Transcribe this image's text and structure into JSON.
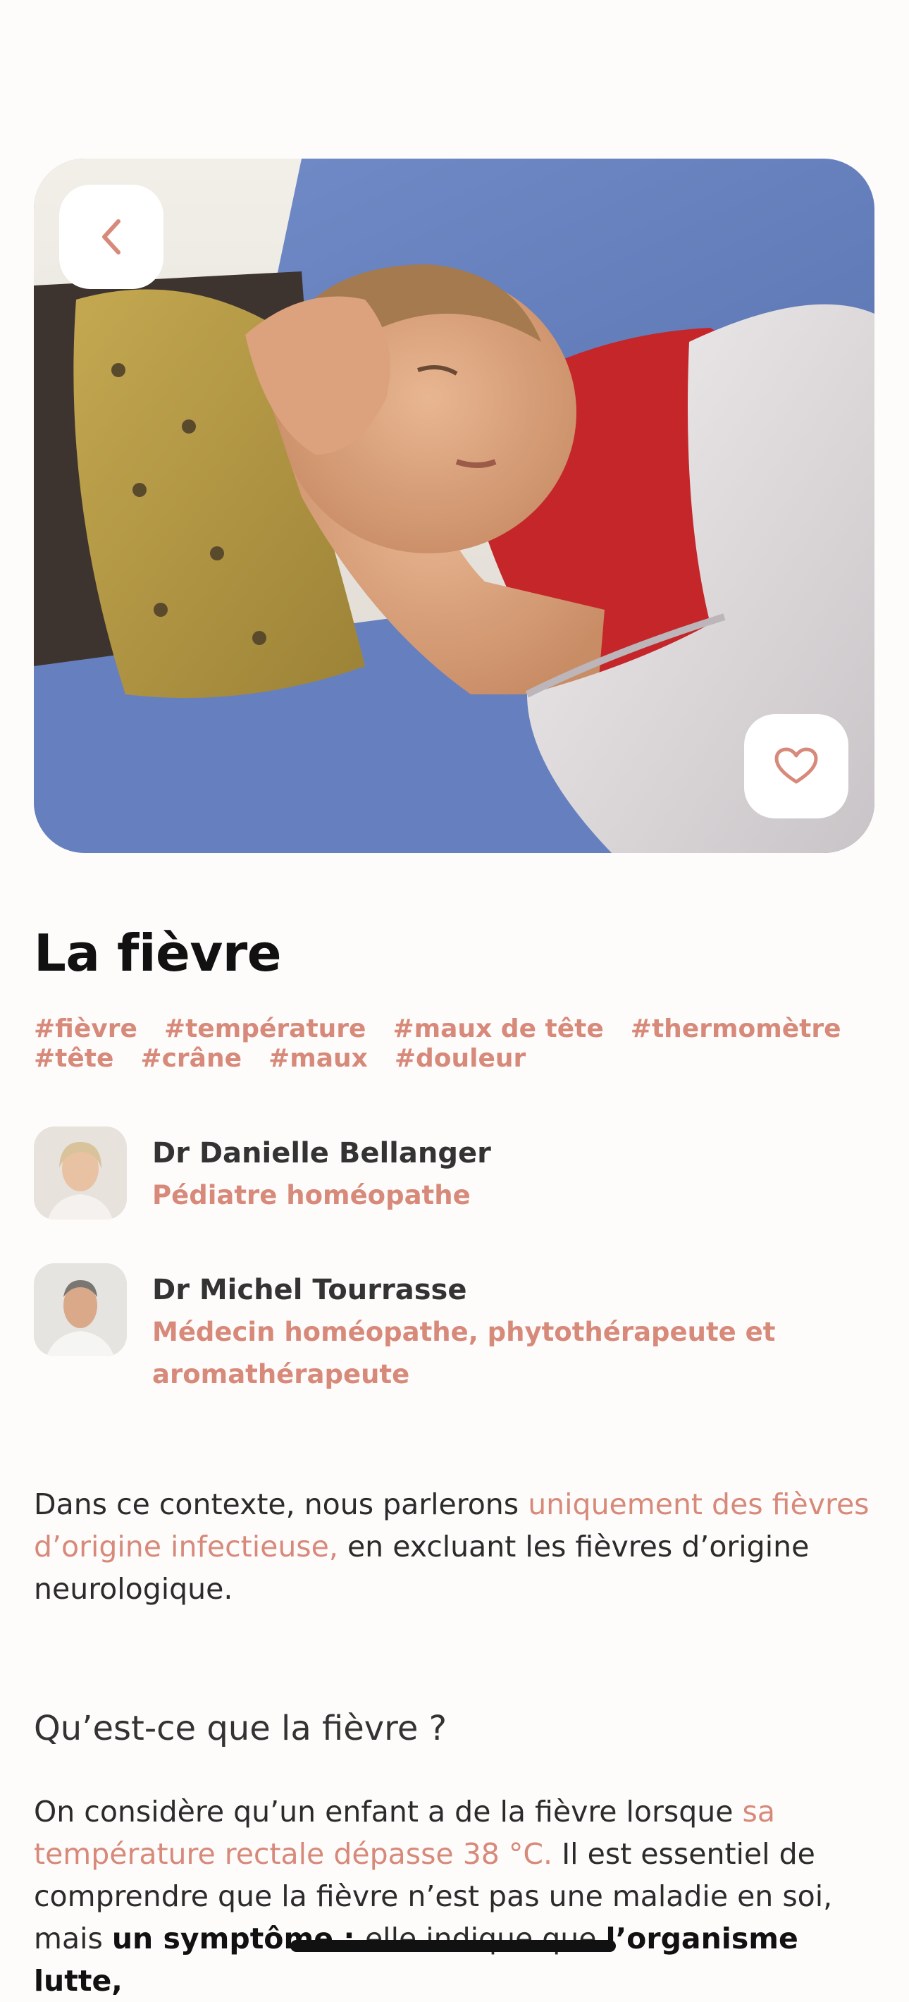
{
  "article": {
    "title": "La fièvre",
    "tags": [
      "#fièvre",
      "#température",
      "#maux de tête",
      "#thermomètre",
      "#tête",
      "#crâne",
      "#maux",
      "#douleur"
    ]
  },
  "authors": [
    {
      "name": "Dr Danielle Bellanger",
      "role": "Pédiatre homéopathe"
    },
    {
      "name": "Dr Michel Tourrasse",
      "role": "Médecin homéopathe, phytothérapeute et aromathérapeute"
    }
  ],
  "intro": {
    "part1": "Dans ce contexte, nous parlerons ",
    "highlight": "uniquement des fièvres d’origine infectieuse,",
    "part2": " en excluant les fièvres d’origine neurologique."
  },
  "section": {
    "title": "Qu’est-ce que la fièvre ?",
    "p_part1": "On considère qu’un enfant a de la fièvre lorsque ",
    "p_highlight": "sa température rectale dépasse 38 °C.",
    "p_part2": " Il est essentiel de comprendre que la fièvre n’est pas une maladie en soi, mais ",
    "p_bold1": "un symptôme : ",
    "p_part3": "elle indique que ",
    "p_bold2": "l’organisme lutte,"
  },
  "icons": {
    "back": "chevron-left-icon",
    "favorite": "heart-outline-icon"
  },
  "colors": {
    "accent": "#d7897a",
    "background": "#fefcfb",
    "text": "#2b2b2b"
  }
}
